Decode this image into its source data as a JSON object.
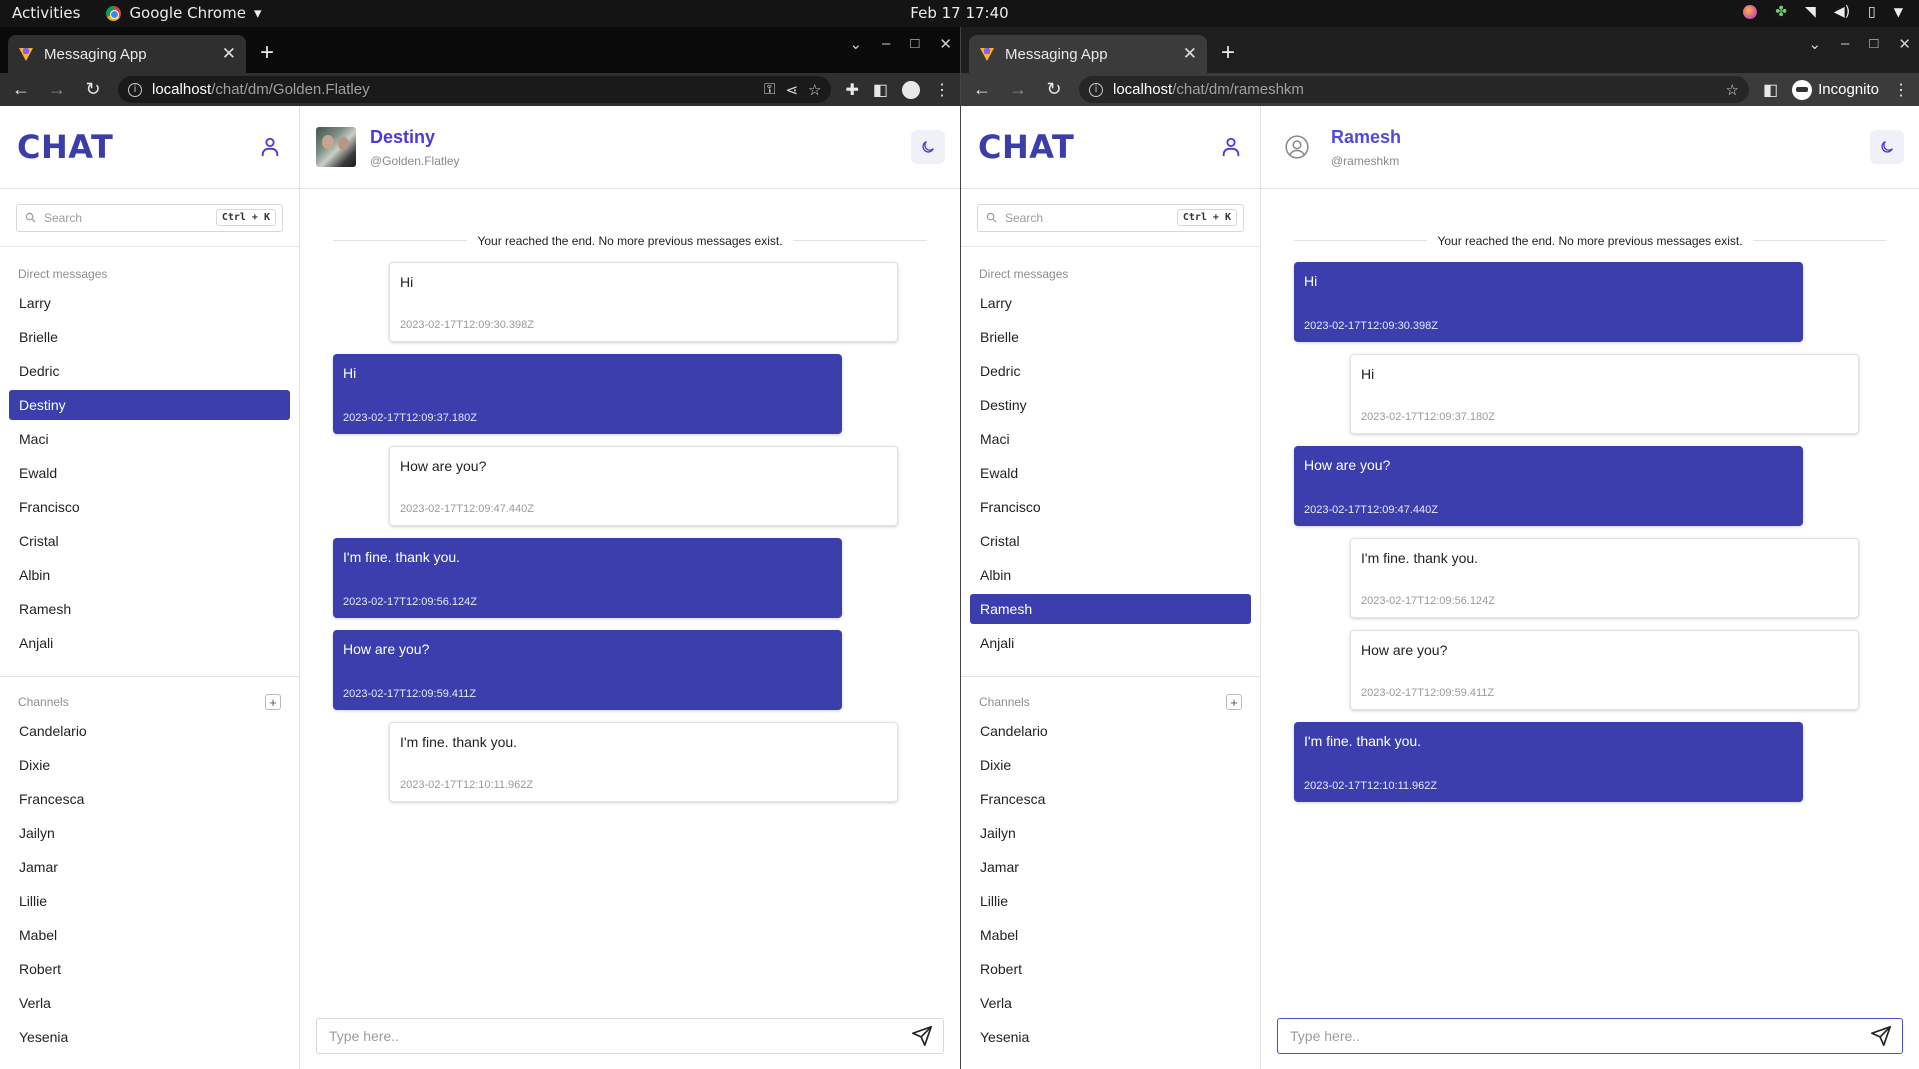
{
  "system_bar": {
    "activities": "Activities",
    "app_name": "Google Chrome",
    "app_menu_arrow": "▾",
    "clock": "Feb 17  17:40"
  },
  "windows": {
    "left": {
      "tab_title": "Messaging App",
      "url_host": "localhost",
      "url_path": "/chat/dm/Golden.Flatley",
      "app": {
        "brand": "CHAT",
        "search_placeholder": "Search",
        "search_shortcut": "Ctrl + K",
        "dm_label": "Direct messages",
        "dm_items": [
          "Larry",
          "Brielle",
          "Dedric",
          "Destiny",
          "Maci",
          "Ewald",
          "Francisco",
          "Cristal",
          "Albin",
          "Ramesh",
          "Anjali"
        ],
        "dm_active": "Destiny",
        "channels_label": "Channels",
        "channel_items": [
          "Candelario",
          "Dixie",
          "Francesca",
          "Jailyn",
          "Jamar",
          "Lillie",
          "Mabel",
          "Robert",
          "Verla",
          "Yesenia"
        ],
        "peer_name": "Destiny",
        "peer_handle": "@Golden.Flatley",
        "end_text": "Your reached the end. No more previous messages exist.",
        "composer_placeholder": "Type here..",
        "messages": [
          {
            "dir": "in",
            "text": "Hi",
            "time": "2023-02-17T12:09:30.398Z"
          },
          {
            "dir": "out",
            "text": "Hi",
            "time": "2023-02-17T12:09:37.180Z"
          },
          {
            "dir": "in",
            "text": "How are you?",
            "time": "2023-02-17T12:09:47.440Z"
          },
          {
            "dir": "out",
            "text": "I'm fine. thank you.",
            "time": "2023-02-17T12:09:56.124Z"
          },
          {
            "dir": "out",
            "text": "How are you?",
            "time": "2023-02-17T12:09:59.411Z"
          },
          {
            "dir": "in",
            "text": "I'm fine. thank you.",
            "time": "2023-02-17T12:10:11.962Z"
          }
        ]
      }
    },
    "right": {
      "tab_title": "Messaging App",
      "url_host": "localhost",
      "url_path": "/chat/dm/rameshkm",
      "incognito_label": "Incognito",
      "app": {
        "brand": "CHAT",
        "search_placeholder": "Search",
        "search_shortcut": "Ctrl + K",
        "dm_label": "Direct messages",
        "dm_items": [
          "Larry",
          "Brielle",
          "Dedric",
          "Destiny",
          "Maci",
          "Ewald",
          "Francisco",
          "Cristal",
          "Albin",
          "Ramesh",
          "Anjali"
        ],
        "dm_active": "Ramesh",
        "channels_label": "Channels",
        "channel_items": [
          "Candelario",
          "Dixie",
          "Francesca",
          "Jailyn",
          "Jamar",
          "Lillie",
          "Mabel",
          "Robert",
          "Verla",
          "Yesenia"
        ],
        "peer_name": "Ramesh",
        "peer_handle": "@rameshkm",
        "end_text": "Your reached the end. No more previous messages exist.",
        "composer_placeholder": "Type here..",
        "messages": [
          {
            "dir": "out",
            "text": "Hi",
            "time": "2023-02-17T12:09:30.398Z"
          },
          {
            "dir": "in",
            "text": "Hi",
            "time": "2023-02-17T12:09:37.180Z"
          },
          {
            "dir": "out",
            "text": "How are you?",
            "time": "2023-02-17T12:09:47.440Z"
          },
          {
            "dir": "in",
            "text": "I'm fine. thank you.",
            "time": "2023-02-17T12:09:56.124Z"
          },
          {
            "dir": "in",
            "text": "How are you?",
            "time": "2023-02-17T12:09:59.411Z"
          },
          {
            "dir": "out",
            "text": "I'm fine. thank you.",
            "time": "2023-02-17T12:10:11.962Z"
          }
        ]
      }
    }
  },
  "colors": {
    "accent": "#3b3eac",
    "brand": "#3b3ea8",
    "peer_name": "#4a3ad9"
  }
}
